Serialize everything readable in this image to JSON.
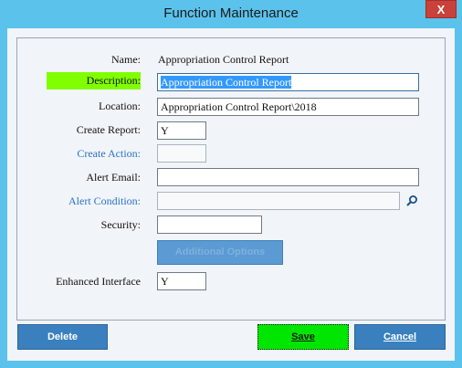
{
  "window": {
    "title": "Function Maintenance",
    "close_label": "X"
  },
  "form": {
    "name_label": "Name:",
    "name_value": "Appropriation Control Report",
    "description_label": "Description:",
    "description_value": "Appropriation Control Report",
    "location_label": "Location:",
    "location_value": "Appropriation Control Report\\2018",
    "create_report_label": "Create Report:",
    "create_report_value": "Y",
    "create_action_label": "Create Action:",
    "create_action_value": "",
    "alert_email_label": "Alert Email:",
    "alert_email_value": "",
    "alert_condition_label": "Alert Condition:",
    "alert_condition_value": "",
    "security_label": "Security:",
    "security_value": "",
    "additional_options_label": "Additional Options",
    "enhanced_interface_label": "Enhanced Interface",
    "enhanced_interface_value": "Y"
  },
  "footer": {
    "delete_label": "Delete",
    "save_label": "Save",
    "cancel_label": "Cancel"
  },
  "colors": {
    "highlight_label": "#80ff00",
    "save_button": "#00e600",
    "primary_button": "#3a80be",
    "window_chrome": "#5bc2ec"
  },
  "icons": {
    "alert_condition_lookup": "search-icon"
  }
}
